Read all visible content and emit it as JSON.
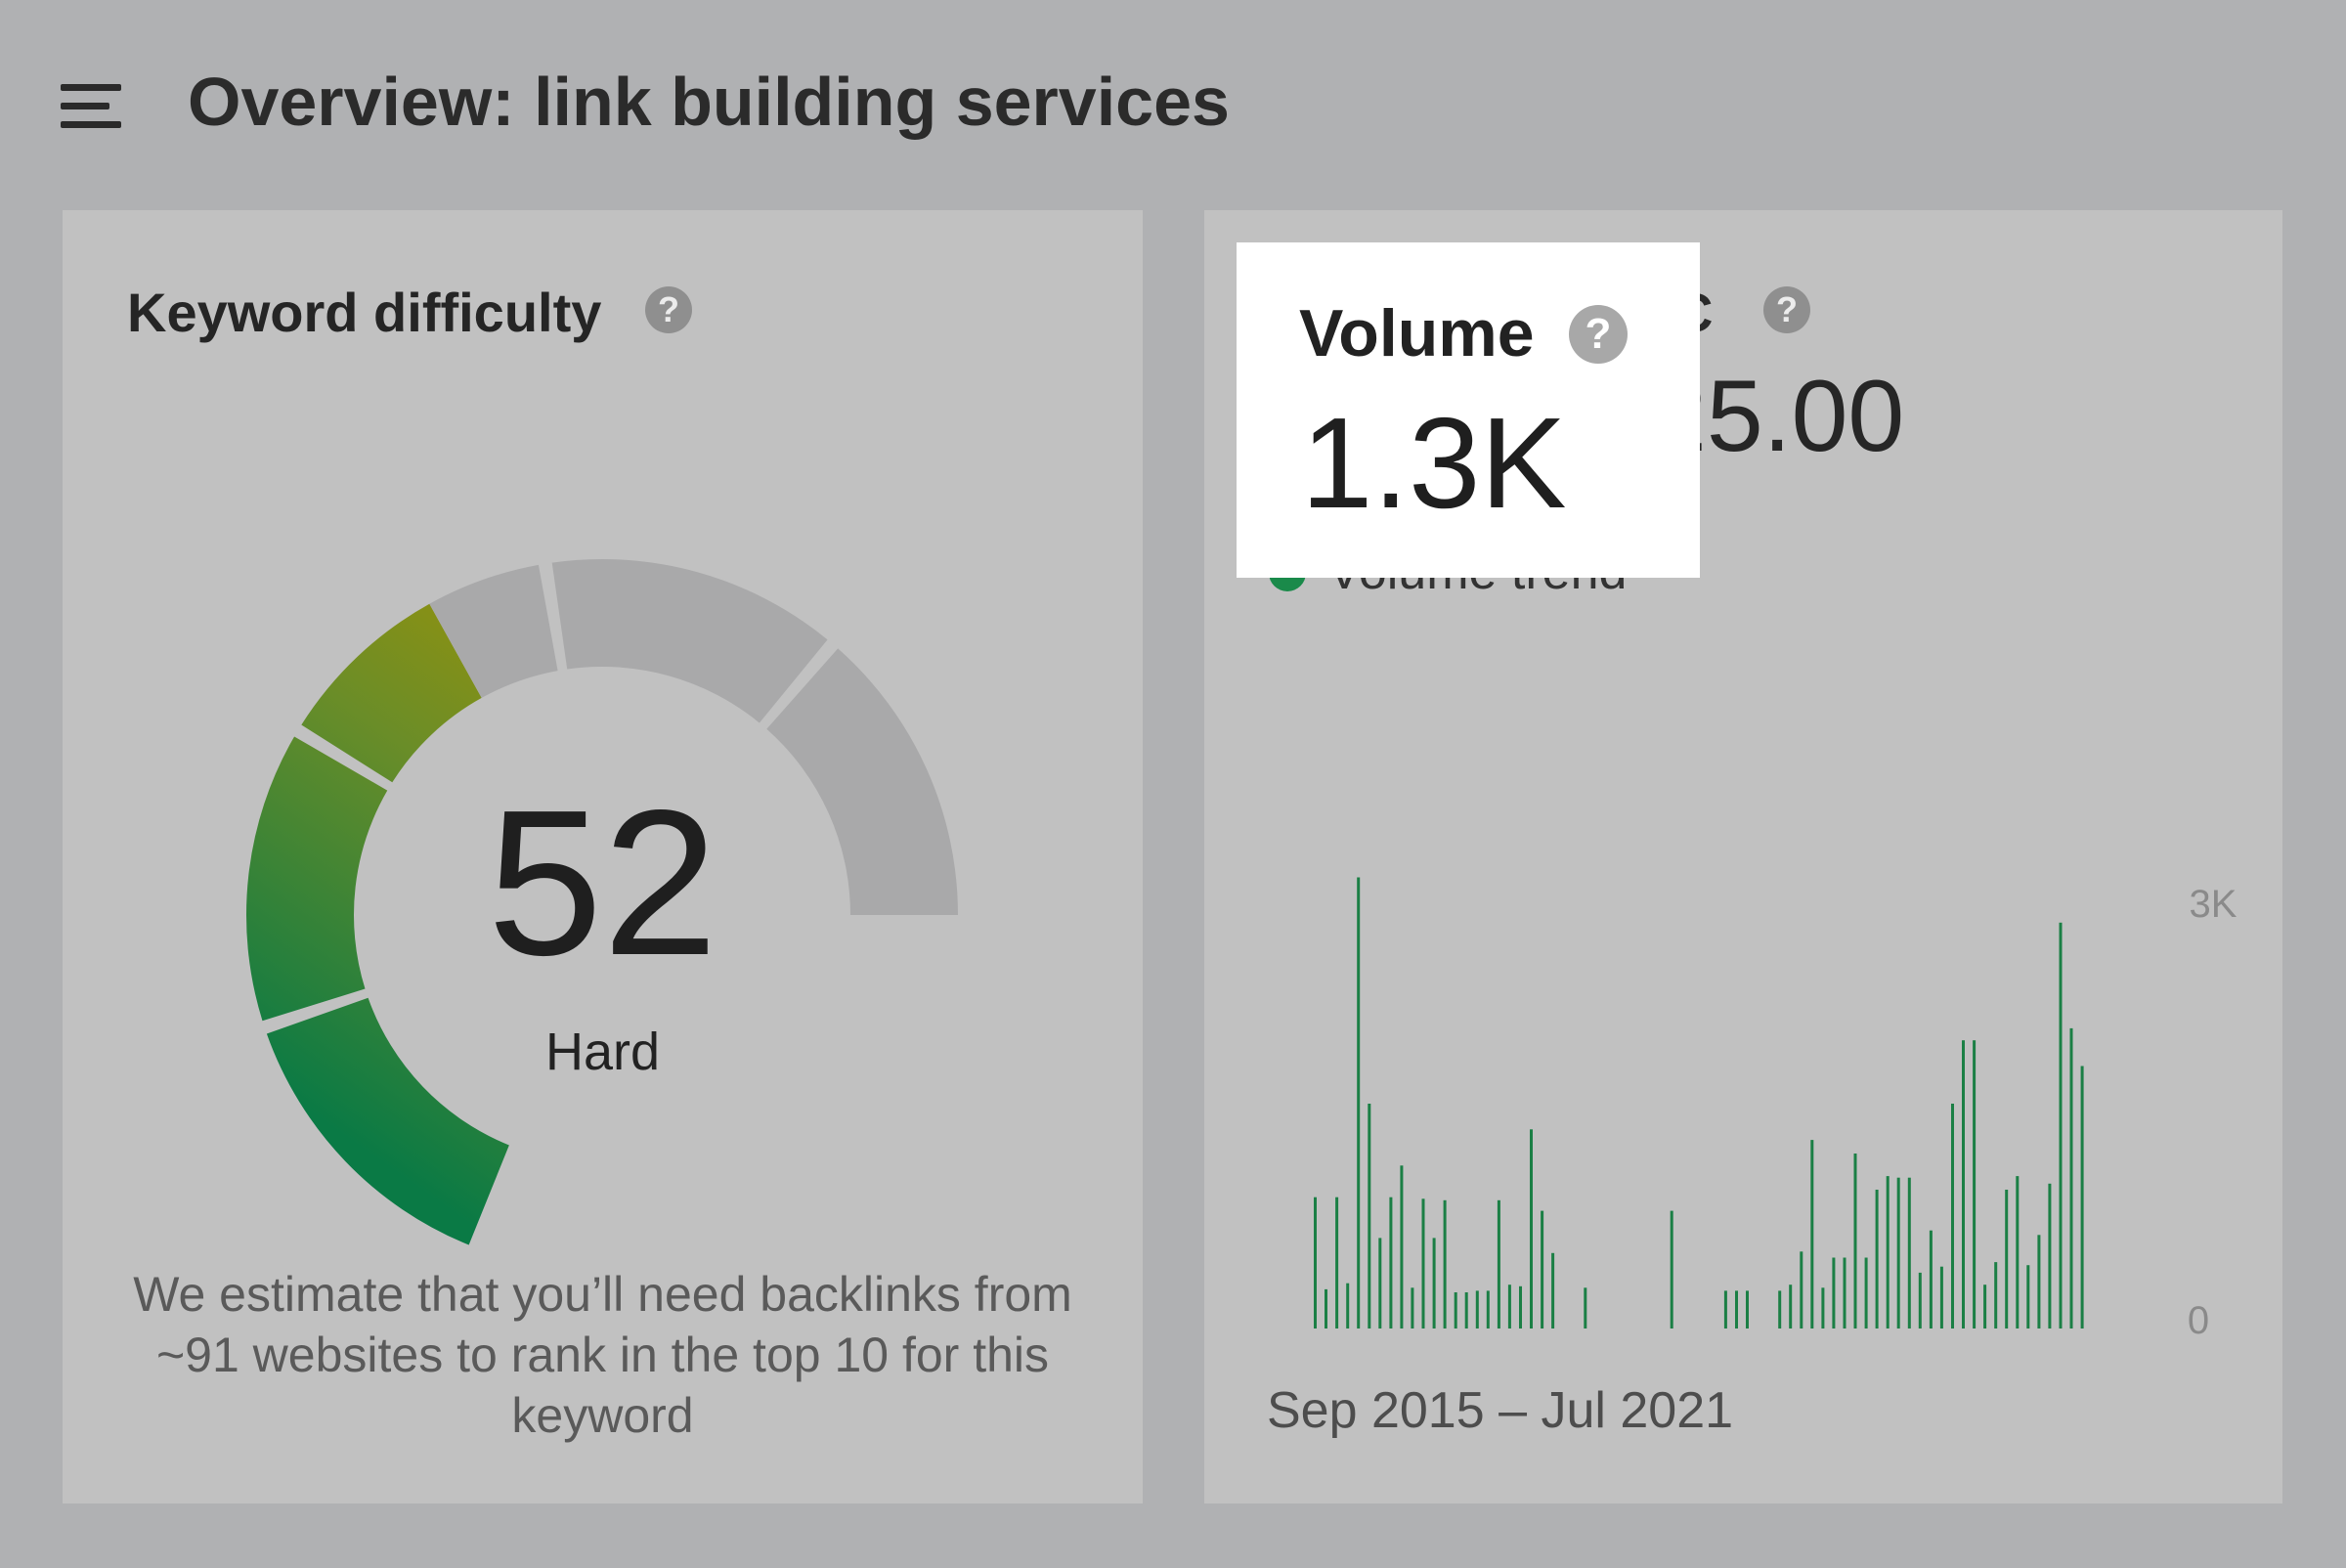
{
  "header": {
    "title": "Overview: link building services",
    "menu_icon": "hamburger-menu-icon"
  },
  "keyword_difficulty": {
    "heading": "Keyword difficulty",
    "help_glyph": "?",
    "score": "52",
    "score_value": 52,
    "level": "Hard",
    "note": "We estimate that you’ll need backlinks from ~91 websites to rank in the top 10 for this keyword",
    "colors": {
      "filled_start": "#0a7a45",
      "filled_mid": "#5f8f2a",
      "filled_end": "#a99400",
      "unfilled": "#a9a9aa"
    }
  },
  "volume": {
    "heading": "Volume",
    "help_glyph": "?",
    "value": "1.3K",
    "cpc_label": "C",
    "cpc_value": "25.00",
    "trend_label": "Volume trend",
    "date_range": "Sep 2015 – Jul 2021",
    "y_max_label": "3K",
    "y_min_label": "0"
  },
  "chart_data": {
    "type": "bar",
    "series": [
      {
        "color": "#1b7f45",
        "values": [
          870,
          260,
          870,
          300,
          2990,
          1490,
          600,
          870,
          1080,
          270,
          860,
          600,
          850,
          240,
          240,
          250,
          250,
          850,
          290,
          280,
          1320,
          780,
          500,
          0,
          0,
          270,
          0,
          0,
          0,
          0,
          0,
          0,
          0,
          780,
          0,
          0,
          0,
          0,
          250,
          250,
          250,
          0,
          0,
          250,
          290,
          510,
          1250,
          270,
          470,
          470,
          1160,
          470,
          920,
          1010,
          1000,
          1000,
          370,
          650,
          410,
          1490,
          1910,
          1910,
          290,
          440,
          920,
          1010,
          420,
          620,
          960,
          2690,
          1990,
          1740
        ]
      }
    ],
    "ylim": [
      0,
      3000
    ],
    "yticks": [
      "3K",
      "0"
    ],
    "x_range": [
      "Sep 2015",
      "Jul 2021"
    ],
    "legend": "Volume trend"
  }
}
